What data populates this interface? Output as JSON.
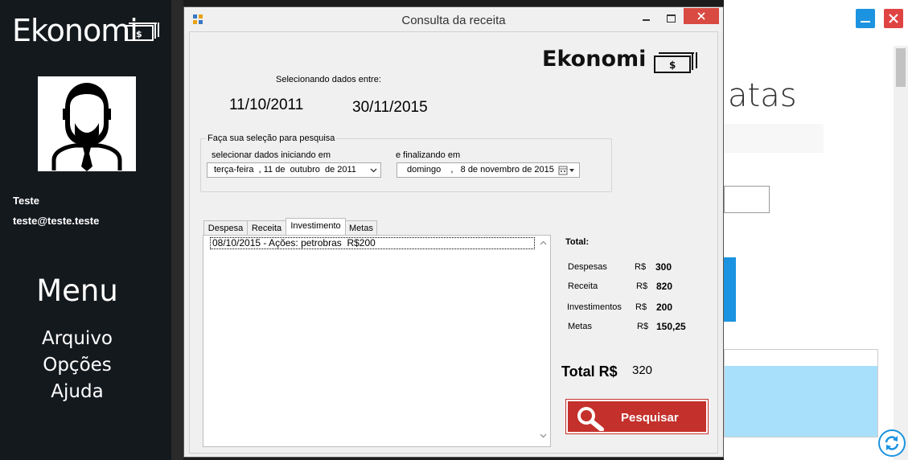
{
  "sidebar": {
    "brand": "Ekonomi",
    "user_name": "Teste",
    "user_email": "teste@teste.teste",
    "menu_title": "Menu",
    "menu_items": [
      "Arquivo",
      "Opções",
      "Ajuda"
    ]
  },
  "background_window": {
    "heading_partial": "atas"
  },
  "dialog": {
    "title": "Consulta da receita",
    "brand": "Ekonomi",
    "range_caption": "Selecionando dados entre:",
    "date_from": "11/10/2011",
    "date_to": "30/11/2015",
    "group_title": "Faça sua seleção para pesquisa",
    "start_label": "selecionar dados iniciando em",
    "start_value": "terça-feira  , 11 de  outubro  de 2011",
    "end_label": "e finalizando em",
    "end_value": "domingo    ,   8 de novembro de 2015",
    "tabs": [
      "Despesa",
      "Receita",
      "Investimento",
      "Metas"
    ],
    "active_tab": "Investimento",
    "list_items": [
      "08/10/2015 - Ações: petrobras  R$200"
    ],
    "summary": {
      "heading": "Total:",
      "currency": "R$",
      "rows": [
        {
          "label": "Despesas",
          "value": "300"
        },
        {
          "label": "Receita",
          "value": "820"
        },
        {
          "label": "Investimentos",
          "value": "200"
        },
        {
          "label": "Metas",
          "value": "150,25"
        }
      ],
      "total_label": "Total R$",
      "total_value": "320"
    },
    "search_button": "Pesquisar"
  },
  "colors": {
    "sidebar_bg": "#14191e",
    "search_button": "#c4302b",
    "close_button": "#e04343",
    "accent_blue": "#1b93e0"
  }
}
